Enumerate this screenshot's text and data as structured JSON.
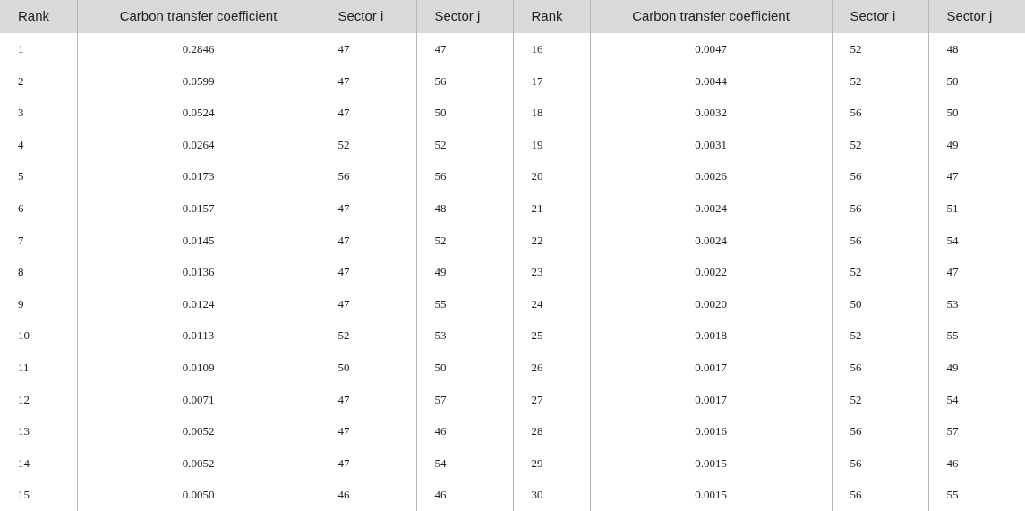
{
  "table": {
    "columns": [
      "Rank",
      "Carbon transfer coefficient",
      "Sector i",
      "Sector j",
      "Rank",
      "Carbon transfer coefficient",
      "Sector i",
      "Sector j"
    ],
    "rows": [
      [
        "1",
        "0.2846",
        "47",
        "47",
        "16",
        "0.0047",
        "52",
        "48"
      ],
      [
        "2",
        "0.0599",
        "47",
        "56",
        "17",
        "0.0044",
        "52",
        "50"
      ],
      [
        "3",
        "0.0524",
        "47",
        "50",
        "18",
        "0.0032",
        "56",
        "50"
      ],
      [
        "4",
        "0.0264",
        "52",
        "52",
        "19",
        "0.0031",
        "52",
        "49"
      ],
      [
        "5",
        "0.0173",
        "56",
        "56",
        "20",
        "0.0026",
        "56",
        "47"
      ],
      [
        "6",
        "0.0157",
        "47",
        "48",
        "21",
        "0.0024",
        "56",
        "51"
      ],
      [
        "7",
        "0.0145",
        "47",
        "52",
        "22",
        "0.0024",
        "56",
        "54"
      ],
      [
        "8",
        "0.0136",
        "47",
        "49",
        "23",
        "0.0022",
        "52",
        "47"
      ],
      [
        "9",
        "0.0124",
        "47",
        "55",
        "24",
        "0.0020",
        "50",
        "53"
      ],
      [
        "10",
        "0.0113",
        "52",
        "53",
        "25",
        "0.0018",
        "52",
        "55"
      ],
      [
        "11",
        "0.0109",
        "50",
        "50",
        "26",
        "0.0017",
        "56",
        "49"
      ],
      [
        "12",
        "0.0071",
        "47",
        "57",
        "27",
        "0.0017",
        "52",
        "54"
      ],
      [
        "13",
        "0.0052",
        "47",
        "46",
        "28",
        "0.0016",
        "56",
        "57"
      ],
      [
        "14",
        "0.0052",
        "47",
        "54",
        "29",
        "0.0015",
        "56",
        "46"
      ],
      [
        "15",
        "0.0050",
        "46",
        "46",
        "30",
        "0.0015",
        "56",
        "55"
      ]
    ]
  }
}
